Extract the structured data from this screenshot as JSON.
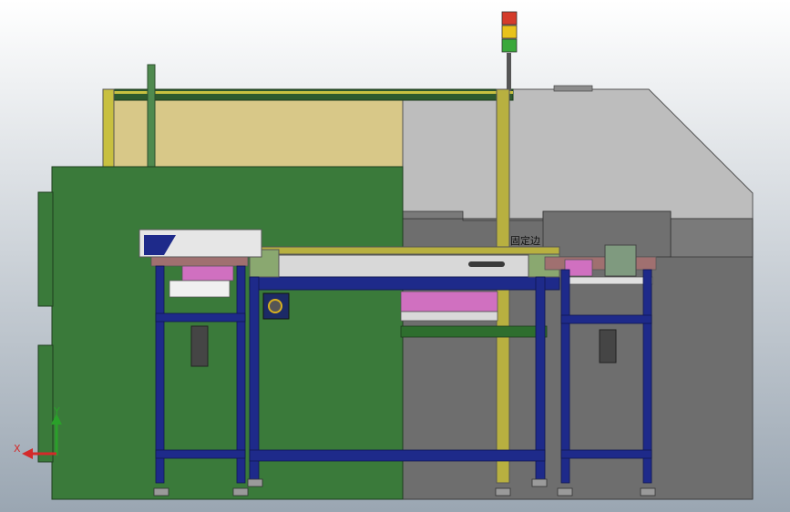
{
  "labels": {
    "fixed_side": "固定边"
  },
  "triad": {
    "x_label": "X",
    "y_label": "Y"
  },
  "signal_tower": {
    "lights": [
      "red",
      "yellow",
      "green"
    ]
  },
  "colors": {
    "background_top": "#ffffff",
    "background_bottom": "#9aa6b2",
    "green_panel": "#3a7a3a",
    "tan_panel": "#d8c888",
    "gray_housing": "#bdbdbd",
    "dark_gray": "#6e6e6e",
    "blue_frame": "#1e2a8a",
    "olive_rail": "#b8b040",
    "pink_part": "#d070c0",
    "conveyor": "#d8d8d8"
  }
}
